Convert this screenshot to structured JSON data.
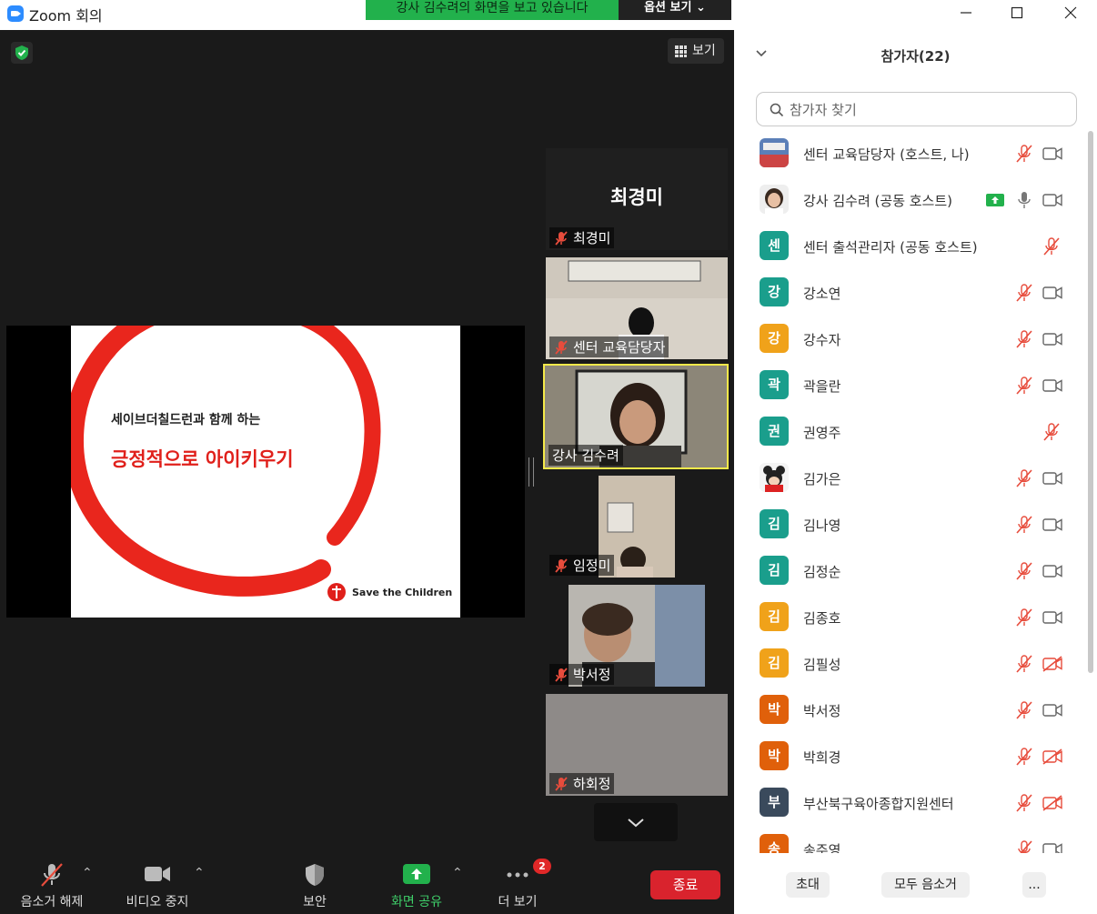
{
  "window": {
    "title": "Zoom 회의"
  },
  "share_banner": {
    "text": "강사 김수려의 화면을 보고 있습니다",
    "options_label": "옵션 보기"
  },
  "view_button": {
    "label": "보기",
    "icon": "grid-icon"
  },
  "slide": {
    "subtitle": "세이브더칠드런과 함께 하는",
    "title": "긍정적으로 아이키우기",
    "org": "Save the Children",
    "accent_color": "#e0201b"
  },
  "video_tiles": [
    {
      "name": "최경미",
      "big_name": "최경미",
      "muted": true,
      "video": false
    },
    {
      "name": "센터 교육담당자",
      "muted": true,
      "video": true
    },
    {
      "name": "강사 김수려",
      "muted": false,
      "video": true,
      "active_speaker": true
    },
    {
      "name": "임정미",
      "muted": true,
      "video": true
    },
    {
      "name": "박서정",
      "muted": true,
      "video": true
    },
    {
      "name": "하회정",
      "muted": true,
      "video": true
    }
  ],
  "toolbar": {
    "unmute_label": "음소거 해제",
    "stop_video_label": "비디오 중지",
    "security_label": "보안",
    "share_label": "화면 공유",
    "more_label": "더 보기",
    "more_badge": "2",
    "end_label": "종료",
    "share_color": "#22b14c"
  },
  "panel": {
    "title": "참가자(22)",
    "search_placeholder": "참가자 찾기",
    "participants": [
      {
        "name": "센터 교육담당자 (호스트, 나)",
        "avatar": "",
        "avatar_type": "photo",
        "mic": "muted",
        "video": "on"
      },
      {
        "name": "강사 김수려 (공동 호스트)",
        "avatar": "",
        "avatar_type": "photo",
        "mic": "on",
        "video": "on",
        "sharing": true
      },
      {
        "name": "센터 출석관리자 (공동 호스트)",
        "avatar": "센",
        "color": "#1a9e8c",
        "mic": "muted",
        "video": "none"
      },
      {
        "name": "강소연",
        "avatar": "강",
        "color": "#1a9e8c",
        "mic": "muted",
        "video": "on"
      },
      {
        "name": "강수자",
        "avatar": "강",
        "color": "#f0a21a",
        "mic": "muted",
        "video": "on"
      },
      {
        "name": "곽을란",
        "avatar": "곽",
        "color": "#1a9e8c",
        "mic": "muted",
        "video": "on"
      },
      {
        "name": "권영주",
        "avatar": "권",
        "color": "#1a9e8c",
        "mic": "muted",
        "video": "none"
      },
      {
        "name": "김가은",
        "avatar": "",
        "avatar_type": "photo",
        "mic": "muted",
        "video": "on"
      },
      {
        "name": "김나영",
        "avatar": "김",
        "color": "#1a9e8c",
        "mic": "muted",
        "video": "on"
      },
      {
        "name": "김정순",
        "avatar": "김",
        "color": "#1a9e8c",
        "mic": "muted",
        "video": "on"
      },
      {
        "name": "김종호",
        "avatar": "김",
        "color": "#f0a21a",
        "mic": "muted",
        "video": "on"
      },
      {
        "name": "김필성",
        "avatar": "김",
        "color": "#f0a21a",
        "mic": "muted",
        "video": "off"
      },
      {
        "name": "박서정",
        "avatar": "박",
        "color": "#e0600a",
        "mic": "muted",
        "video": "on"
      },
      {
        "name": "박희경",
        "avatar": "박",
        "color": "#e0600a",
        "mic": "muted",
        "video": "off"
      },
      {
        "name": "부산북구육아종합지원센터",
        "avatar": "부",
        "color": "#3a4a5c",
        "mic": "muted",
        "video": "off"
      },
      {
        "name": "송주영",
        "avatar": "송",
        "color": "#e0600a",
        "mic": "muted",
        "video": "on"
      }
    ],
    "invite_label": "초대",
    "mute_all_label": "모두 음소거",
    "more_label": "..."
  }
}
